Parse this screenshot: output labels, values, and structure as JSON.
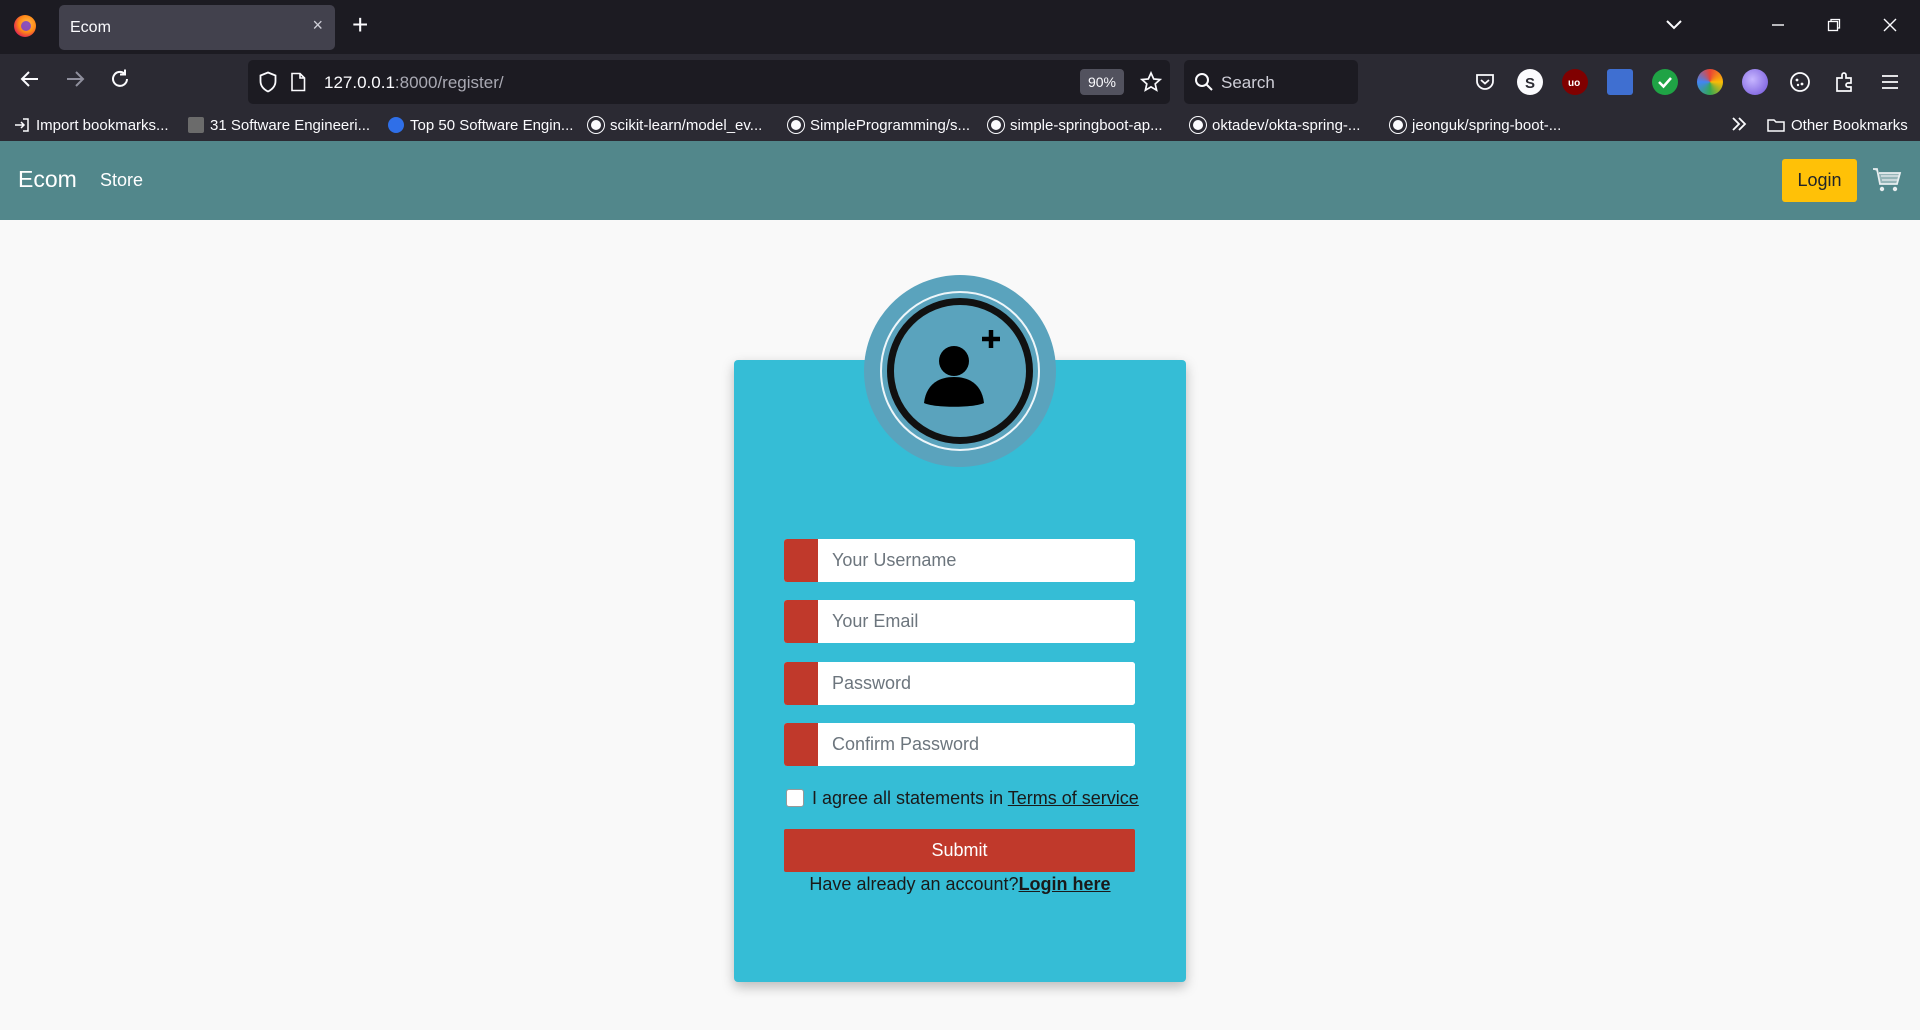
{
  "browser": {
    "tab_title": "Ecom",
    "tab_close": "×",
    "new_tab": "+",
    "url_host": "127.0.0.1",
    "url_path": ":8000/register/",
    "zoom": "90%",
    "search_placeholder": "Search",
    "bookmarks": [
      {
        "label": "Import bookmarks...",
        "icon": "import-icon"
      },
      {
        "label": "31 Software Engineeri...",
        "icon": "bookmark-favicon"
      },
      {
        "label": "Top 50 Software Engin...",
        "icon": "globe-icon"
      },
      {
        "label": "scikit-learn/model_ev...",
        "icon": "github-icon"
      },
      {
        "label": "SimpleProgramming/s...",
        "icon": "github-icon"
      },
      {
        "label": "simple-springboot-ap...",
        "icon": "github-icon"
      },
      {
        "label": "oktadev/okta-spring-...",
        "icon": "github-icon"
      },
      {
        "label": "jeonguk/spring-boot-...",
        "icon": "github-icon"
      }
    ],
    "other_bookmarks": "Other Bookmarks"
  },
  "site": {
    "brand": "Ecom",
    "store_link": "Store",
    "login_button": "Login"
  },
  "form": {
    "username_placeholder": "Your Username",
    "email_placeholder": "Your Email",
    "password_placeholder": "Password",
    "confirm_placeholder": "Confirm Password",
    "agree_text": "I agree all statements in ",
    "terms_link": "Terms of service",
    "submit_label": "Submit",
    "already_text": "Have already an account?",
    "login_here": "Login here"
  },
  "colors": {
    "nav_bg": "#52878b",
    "card_bg": "#35bdd6",
    "accent_red": "#c0392b",
    "login_yellow": "#ffc107"
  }
}
